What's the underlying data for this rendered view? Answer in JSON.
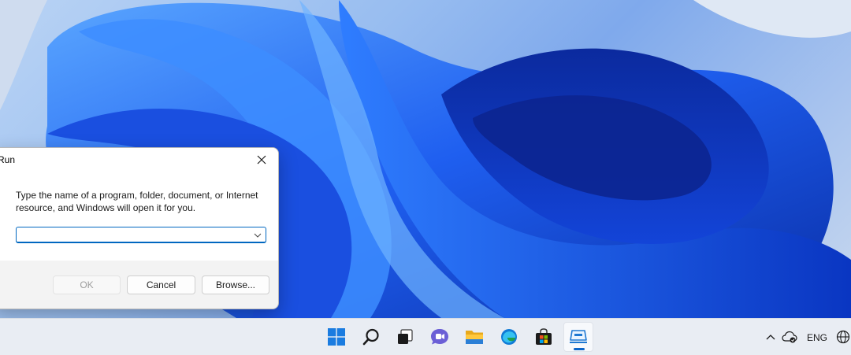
{
  "run_dialog": {
    "title": "Run",
    "description": "Type the name of a program, folder, document, or Internet resource, and Windows will open it for you.",
    "input_value": "",
    "buttons": {
      "ok": "OK",
      "cancel": "Cancel",
      "browse": "Browse..."
    }
  },
  "taskbar": {
    "apps": [
      {
        "name": "start",
        "icon": "windows-logo-icon"
      },
      {
        "name": "search",
        "icon": "search-icon"
      },
      {
        "name": "task-view",
        "icon": "task-view-icon"
      },
      {
        "name": "teams-chat",
        "icon": "chat-icon"
      },
      {
        "name": "file-explorer",
        "icon": "folder-icon"
      },
      {
        "name": "edge",
        "icon": "edge-icon"
      },
      {
        "name": "store",
        "icon": "store-icon"
      },
      {
        "name": "run",
        "icon": "run-icon",
        "active": true
      }
    ],
    "tray": {
      "language": "ENG"
    }
  },
  "colors": {
    "accent": "#0067c0",
    "wallpaper_blue": "#1f55e0",
    "taskbar": "#e9edf3"
  }
}
